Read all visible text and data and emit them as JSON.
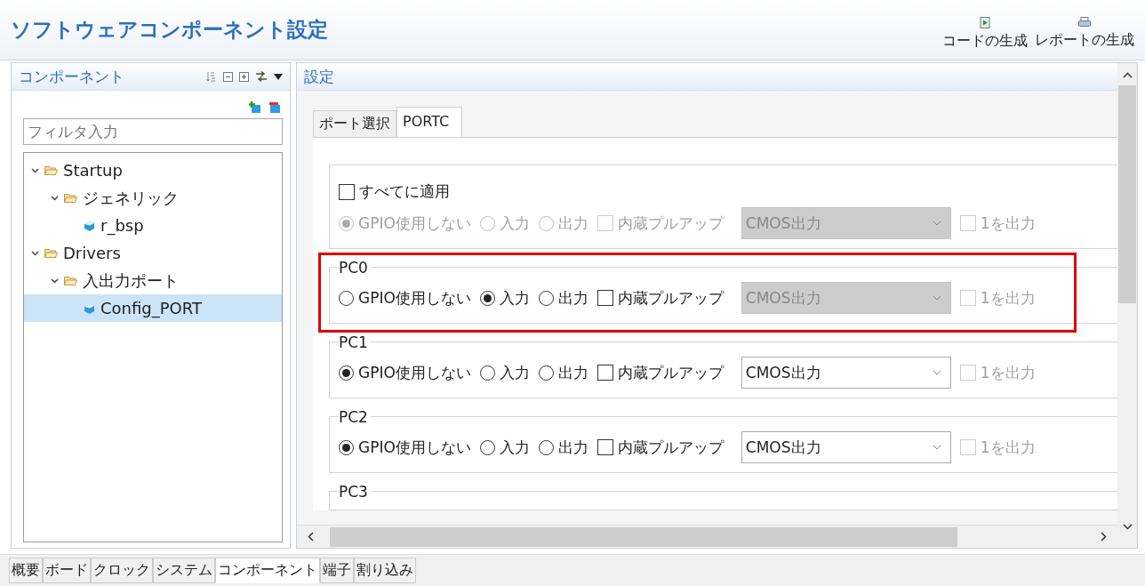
{
  "header": {
    "title": "ソフトウェアコンポーネント設定",
    "actions": [
      {
        "kind": "code",
        "label": "コードの生成"
      },
      {
        "kind": "report",
        "label": "レポートの生成"
      }
    ]
  },
  "components_panel": {
    "title": "コンポーネント",
    "filter": {
      "placeholder": "フィルタ入力"
    },
    "tree": [
      {
        "kind": "folder",
        "label": "Startup",
        "expanded": true,
        "selected": false,
        "children": [
          {
            "kind": "folder",
            "label": "ジェネリック",
            "expanded": true,
            "selected": false,
            "children": [
              {
                "kind": "component",
                "label": "r_bsp",
                "selected": false
              }
            ]
          }
        ]
      },
      {
        "kind": "folder",
        "label": "Drivers",
        "expanded": true,
        "selected": false,
        "children": [
          {
            "kind": "folder",
            "label": "入出力ポート",
            "expanded": true,
            "selected": false,
            "children": [
              {
                "kind": "component",
                "label": "Config_PORT",
                "selected": true
              }
            ]
          }
        ]
      }
    ]
  },
  "settings_panel": {
    "title": "設定",
    "tabs": [
      {
        "label": "ポート選択",
        "selected": false
      },
      {
        "label": "PORTC",
        "selected": true
      }
    ],
    "apply_all": {
      "label": "すべてに適用",
      "checked": false
    },
    "groups": [
      {
        "kind": "all",
        "highlighted": false,
        "disabled": true,
        "options": [
          {
            "label": "GPIO使用しない",
            "selected": true
          },
          {
            "label": "入力",
            "selected": false
          },
          {
            "label": "出力",
            "selected": false
          }
        ],
        "pullup": {
          "label": "内蔵プルアップ",
          "checked": false
        },
        "output_mode": {
          "value": "CMOS出力",
          "disabled": true
        },
        "output_one": {
          "label": "1を出力",
          "checked": false
        }
      },
      {
        "kind": "pin",
        "title": "PC0",
        "highlighted": true,
        "disabled": false,
        "options": [
          {
            "label": "GPIO使用しない",
            "selected": false
          },
          {
            "label": "入力",
            "selected": true
          },
          {
            "label": "出力",
            "selected": false
          }
        ],
        "pullup": {
          "label": "内蔵プルアップ",
          "checked": false
        },
        "output_mode": {
          "value": "CMOS出力",
          "disabled": true
        },
        "output_one": {
          "label": "1を出力",
          "checked": false,
          "disabled": true
        }
      },
      {
        "kind": "pin",
        "title": "PC1",
        "highlighted": false,
        "disabled": false,
        "options": [
          {
            "label": "GPIO使用しない",
            "selected": true
          },
          {
            "label": "入力",
            "selected": false
          },
          {
            "label": "出力",
            "selected": false
          }
        ],
        "pullup": {
          "label": "内蔵プルアップ",
          "checked": false
        },
        "output_mode": {
          "value": "CMOS出力",
          "disabled": false
        },
        "output_one": {
          "label": "1を出力",
          "checked": false,
          "disabled": true
        }
      },
      {
        "kind": "pin",
        "title": "PC2",
        "highlighted": false,
        "disabled": false,
        "options": [
          {
            "label": "GPIO使用しない",
            "selected": true
          },
          {
            "label": "入力",
            "selected": false
          },
          {
            "label": "出力",
            "selected": false
          }
        ],
        "pullup": {
          "label": "内蔵プルアップ",
          "checked": false
        },
        "output_mode": {
          "value": "CMOS出力",
          "disabled": false
        },
        "output_one": {
          "label": "1を出力",
          "checked": false,
          "disabled": true
        }
      },
      {
        "kind": "pin",
        "title": "PC3"
      }
    ]
  },
  "bottom_tabs": [
    {
      "label": "概要",
      "selected": false
    },
    {
      "label": "ボード",
      "selected": false
    },
    {
      "label": "クロック",
      "selected": false
    },
    {
      "label": "システム",
      "selected": false
    },
    {
      "label": "コンポーネント",
      "selected": true
    },
    {
      "label": "端子",
      "selected": false
    },
    {
      "label": "割り込み",
      "selected": false
    }
  ]
}
